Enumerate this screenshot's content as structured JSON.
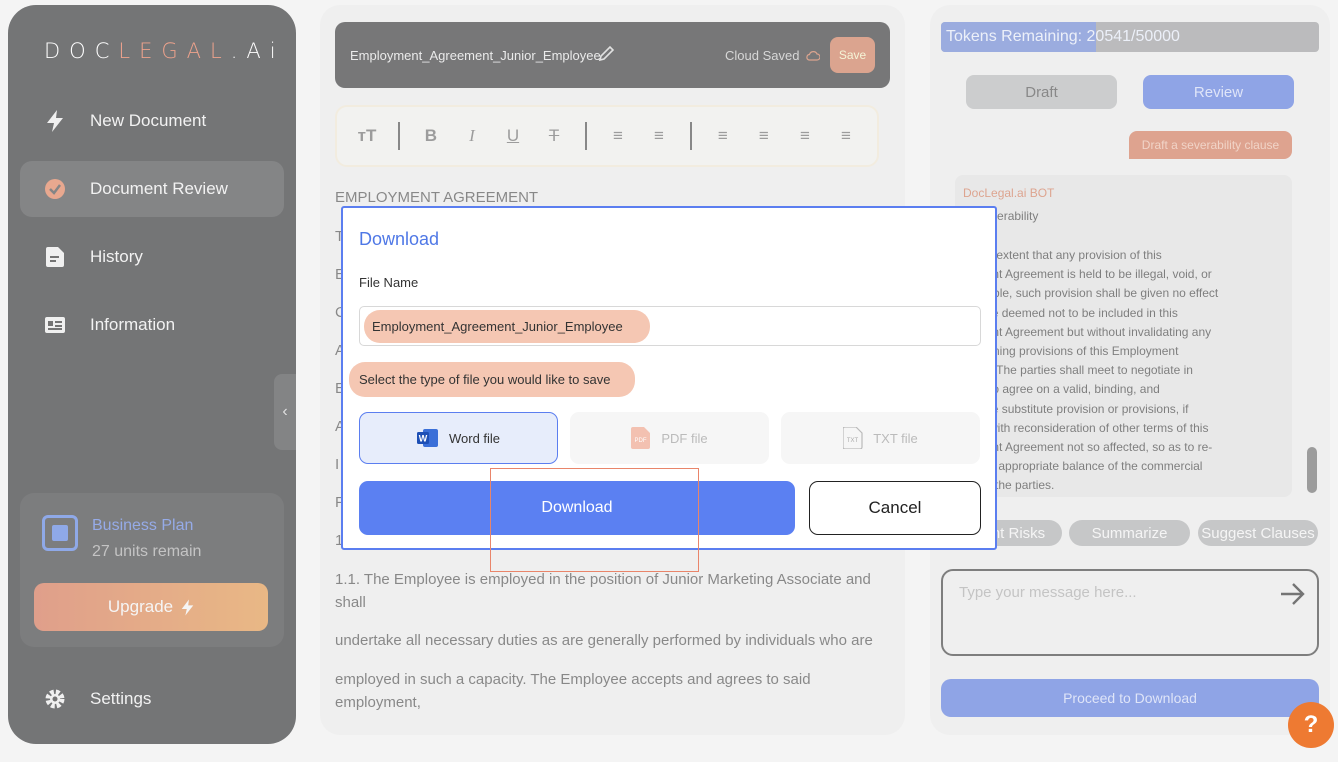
{
  "sidebar": {
    "logo": {
      "part1": "DOC",
      "part2": "LEGAL",
      "part3": ".Ai"
    },
    "items": [
      {
        "label": "New Document",
        "icon": "bolt-icon"
      },
      {
        "label": "Document Review",
        "icon": "check-circle-icon",
        "active": true
      },
      {
        "label": "History",
        "icon": "document-icon"
      },
      {
        "label": "Information",
        "icon": "id-card-icon"
      }
    ],
    "plan": {
      "name": "Business Plan",
      "units": "27 units remain",
      "upgrade_label": "Upgrade"
    },
    "settings_label": "Settings"
  },
  "editor": {
    "title": "Employment_Agreement_Junior_Employee",
    "cloud_saved": "Cloud Saved",
    "save_label": "Save",
    "toolbar_text_size": "тT",
    "heading": "EMPLOYMENT AGREEMENT",
    "paragraph_letters": [
      "T",
      "E",
      "C",
      "A",
      "E",
      "A",
      "I",
      "F",
      "1"
    ],
    "para1": "1.1. The Employee is employed in the position of Junior Marketing Associate and shall",
    "para2": "undertake all necessary duties as are generally performed by individuals who are",
    "para3": "employed in such a capacity. The Employee accepts and agrees to said employment,"
  },
  "right_panel": {
    "tokens_label": "Tokens Remaining: 20541/50000",
    "tokens_remaining": 20541,
    "tokens_total": 50000,
    "tabs": {
      "draft": "Draft",
      "review": "Review"
    },
    "user_chip": "Draft a severability clause",
    "bot": {
      "name": "DocLegal.ai BOT",
      "subtitle": "3. Severability",
      "lines": [
        "to the extent that any provision of this",
        "oyment Agreement is held to be illegal, void, or",
        "orceable, such provision shall be given no effect",
        "hall be deemed not to be included in this",
        "oyment Agreement but without invalidating any",
        "remaining provisions of this Employment",
        "ment. The parties shall meet to negotiate in",
        "faith to agree on a valid, binding, and",
        "ceable substitute provision or provisions, if",
        "sary with reconsideration of other terms of this",
        "oyment Agreement not so affected, so as to re-",
        "ish an appropriate balance of the commercial",
        "sts of the parties."
      ]
    },
    "actions": {
      "risks": "ht Risks",
      "summarize": "Summarize",
      "suggest": "Suggest Clauses"
    },
    "message_placeholder": "Type your message here...",
    "proceed_label": "Proceed to Download",
    "help_label": "?"
  },
  "modal": {
    "title": "Download",
    "file_name_label": "File Name",
    "file_name_value": "Employment_Agreement_Junior_Employee",
    "type_hint": "Select the type of file you would like to save",
    "file_types": {
      "word": "Word file",
      "pdf": "PDF file",
      "txt": "TXT file"
    },
    "download_label": "Download",
    "cancel_label": "Cancel"
  },
  "colors": {
    "accent_orange": "#e2603a",
    "accent_blue": "#5b80f2",
    "sidebar_bg": "#111214"
  }
}
